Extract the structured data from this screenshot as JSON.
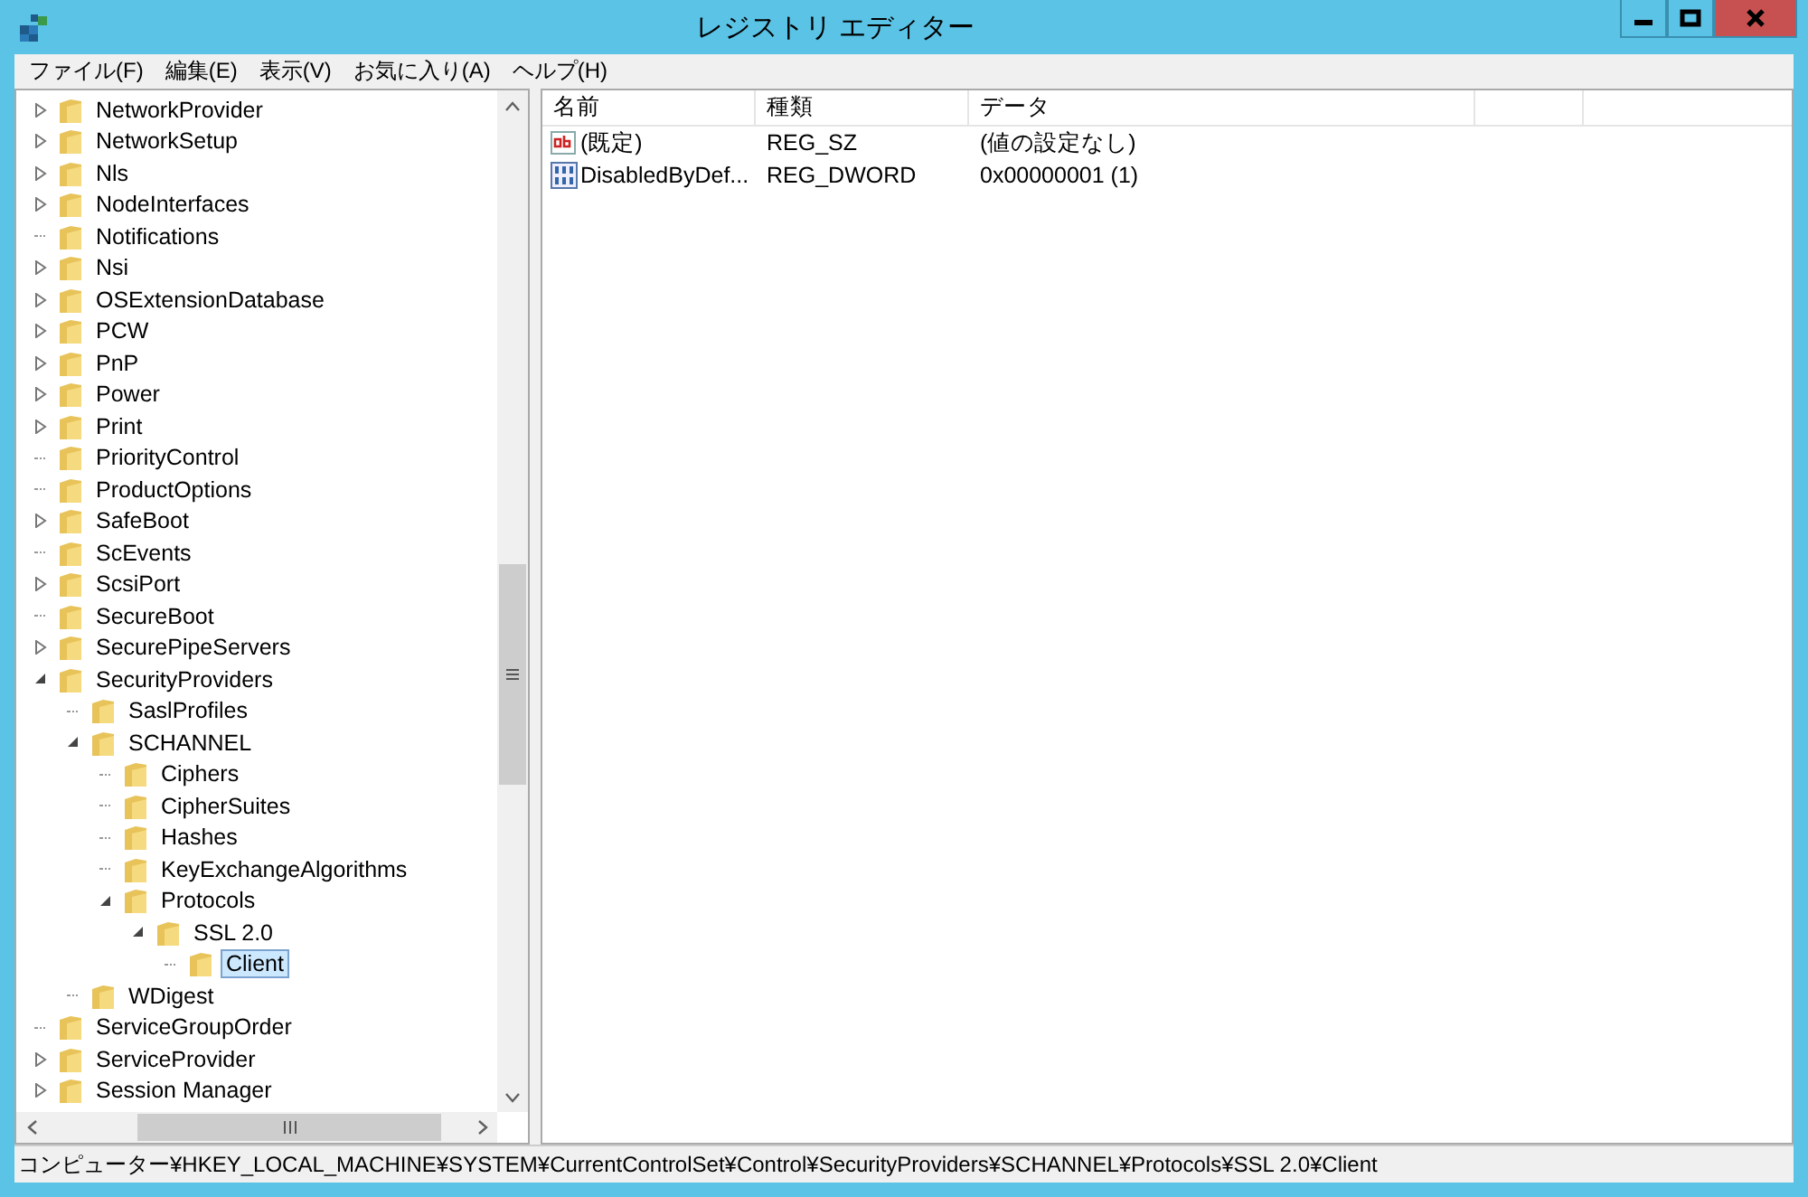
{
  "window": {
    "title": "レジストリ エディター"
  },
  "menu": [
    "ファイル(F)",
    "編集(E)",
    "表示(V)",
    "お気に入り(A)",
    "ヘルプ(H)"
  ],
  "tree": {
    "items": [
      {
        "label": "NetworkProvider",
        "has_children": true,
        "expanded": false,
        "selected": false
      },
      {
        "label": "NetworkSetup",
        "has_children": true,
        "expanded": false,
        "selected": false
      },
      {
        "label": "Nls",
        "has_children": true,
        "expanded": false,
        "selected": false
      },
      {
        "label": "NodeInterfaces",
        "has_children": true,
        "expanded": false,
        "selected": false
      },
      {
        "label": "Notifications",
        "has_children": false,
        "selected": false
      },
      {
        "label": "Nsi",
        "has_children": true,
        "expanded": false,
        "selected": false
      },
      {
        "label": "OSExtensionDatabase",
        "has_children": true,
        "expanded": false,
        "selected": false
      },
      {
        "label": "PCW",
        "has_children": true,
        "expanded": false,
        "selected": false
      },
      {
        "label": "PnP",
        "has_children": true,
        "expanded": false,
        "selected": false
      },
      {
        "label": "Power",
        "has_children": true,
        "expanded": false,
        "selected": false
      },
      {
        "label": "Print",
        "has_children": true,
        "expanded": false,
        "selected": false
      },
      {
        "label": "PriorityControl",
        "has_children": false,
        "selected": false
      },
      {
        "label": "ProductOptions",
        "has_children": false,
        "selected": false
      },
      {
        "label": "SafeBoot",
        "has_children": true,
        "expanded": false,
        "selected": false
      },
      {
        "label": "ScEvents",
        "has_children": false,
        "selected": false
      },
      {
        "label": "ScsiPort",
        "has_children": true,
        "expanded": false,
        "selected": false
      },
      {
        "label": "SecureBoot",
        "has_children": false,
        "selected": false
      },
      {
        "label": "SecurePipeServers",
        "has_children": true,
        "expanded": false,
        "selected": false
      },
      {
        "label": "SecurityProviders",
        "has_children": true,
        "expanded": true,
        "selected": false,
        "children": [
          {
            "label": "SaslProfiles",
            "has_children": false,
            "selected": false
          },
          {
            "label": "SCHANNEL",
            "has_children": true,
            "expanded": true,
            "selected": false,
            "children": [
              {
                "label": "Ciphers",
                "has_children": false,
                "selected": false
              },
              {
                "label": "CipherSuites",
                "has_children": false,
                "selected": false
              },
              {
                "label": "Hashes",
                "has_children": false,
                "selected": false
              },
              {
                "label": "KeyExchangeAlgorithms",
                "has_children": false,
                "selected": false
              },
              {
                "label": "Protocols",
                "has_children": true,
                "expanded": true,
                "selected": false,
                "children": [
                  {
                    "label": "SSL 2.0",
                    "has_children": true,
                    "expanded": true,
                    "selected": false,
                    "children": [
                      {
                        "label": "Client",
                        "has_children": false,
                        "selected": true
                      }
                    ]
                  }
                ]
              }
            ]
          },
          {
            "label": "WDigest",
            "has_children": false,
            "selected": false
          }
        ]
      },
      {
        "label": "ServiceGroupOrder",
        "has_children": false,
        "selected": false
      },
      {
        "label": "ServiceProvider",
        "has_children": true,
        "expanded": false,
        "selected": false
      },
      {
        "label": "Session Manager",
        "has_children": true,
        "expanded": false,
        "selected": false
      }
    ]
  },
  "values": {
    "columns": [
      "名前",
      "種類",
      "データ"
    ],
    "rows": [
      {
        "kind": "string",
        "name": "(既定)",
        "type": "REG_SZ",
        "data": "(値の設定なし)"
      },
      {
        "kind": "binary",
        "name": "DisabledByDef...",
        "type": "REG_DWORD",
        "data": "0x00000001 (1)"
      }
    ]
  },
  "status_bar": "コンピューター¥HKEY_LOCAL_MACHINE¥SYSTEM¥CurrentControlSet¥Control¥SecurityProviders¥SCHANNEL¥Protocols¥SSL 2.0¥Client"
}
